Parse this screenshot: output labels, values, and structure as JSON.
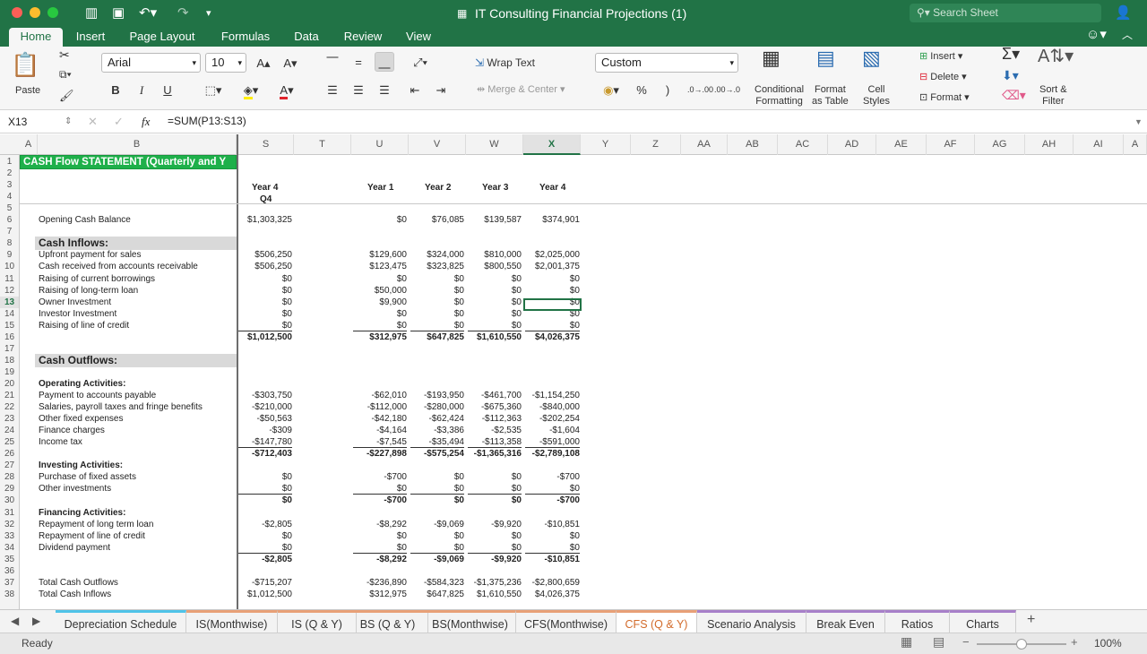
{
  "window": {
    "title": "IT Consulting  Financial Projections (1)",
    "search_placeholder": "Search Sheet"
  },
  "ribbon_tabs": [
    {
      "label": "Home",
      "active": true
    },
    {
      "label": "Insert"
    },
    {
      "label": "Page Layout"
    },
    {
      "label": "Formulas"
    },
    {
      "label": "Data"
    },
    {
      "label": "Review"
    },
    {
      "label": "View"
    }
  ],
  "ribbon": {
    "paste": "Paste",
    "font_name": "Arial",
    "font_size": "10",
    "bold": "B",
    "italic": "I",
    "underline": "U",
    "wrap_text": "Wrap Text",
    "merge_center": "Merge & Center",
    "number_format": "Custom",
    "percent": "%",
    "comma": ")",
    "cond_format": [
      "Conditional",
      "Formatting"
    ],
    "format_table": [
      "Format",
      "as Table"
    ],
    "cell_styles": [
      "Cell",
      "Styles"
    ],
    "insert": "Insert",
    "delete": "Delete",
    "format": "Format",
    "sort_filter": [
      "Sort &",
      "Filter"
    ]
  },
  "formula_bar": {
    "cell_ref": "X13",
    "fx": "fx",
    "formula": "=SUM(P13:S13)"
  },
  "columns": [
    "A",
    "B",
    "S",
    "T",
    "U",
    "V",
    "W",
    "X",
    "Y",
    "Z",
    "AA",
    "AB",
    "AC",
    "AD",
    "AE",
    "AF",
    "AG",
    "AH",
    "AI",
    "A"
  ],
  "selected_column": "X",
  "selected_row": "13",
  "sheet": {
    "title": "CASH Flow STATEMENT (Quarterly and Y",
    "headers": {
      "s": [
        "Year 4",
        "Q4"
      ],
      "u": "Year 1",
      "v": "Year 2",
      "w": "Year 3",
      "x": "Year 4"
    },
    "rows": [
      {
        "r": "1"
      },
      {
        "r": "2"
      },
      {
        "r": "3"
      },
      {
        "r": "4"
      },
      {
        "r": "5"
      },
      {
        "r": "6",
        "b": "Opening Cash Balance",
        "s": "$1,303,325",
        "u": "$0",
        "v": "$76,085",
        "w": "$139,587",
        "x": "$374,901"
      },
      {
        "r": "7"
      },
      {
        "r": "8",
        "b": "Cash Inflows:",
        "section": true
      },
      {
        "r": "9",
        "b": "Upfront payment for sales",
        "s": "$506,250",
        "u": "$129,600",
        "v": "$324,000",
        "w": "$810,000",
        "x": "$2,025,000"
      },
      {
        "r": "10",
        "b": "Cash received from accounts receivable",
        "s": "$506,250",
        "u": "$123,475",
        "v": "$323,825",
        "w": "$800,550",
        "x": "$2,001,375"
      },
      {
        "r": "11",
        "b": "Raising of current borrowings",
        "s": "$0",
        "u": "$0",
        "v": "$0",
        "w": "$0",
        "x": "$0"
      },
      {
        "r": "12",
        "b": "Raising of long-term loan",
        "s": "$0",
        "u": "$50,000",
        "v": "$0",
        "w": "$0",
        "x": "$0"
      },
      {
        "r": "13",
        "b": "Owner Investment",
        "s": "$0",
        "u": "$9,900",
        "v": "$0",
        "w": "$0",
        "x": "$0"
      },
      {
        "r": "14",
        "b": "Investor Investment",
        "s": "$0",
        "u": "$0",
        "v": "$0",
        "w": "$0",
        "x": "$0"
      },
      {
        "r": "15",
        "b": "Raising of line of credit",
        "s": "$0",
        "u": "$0",
        "v": "$0",
        "w": "$0",
        "x": "$0"
      },
      {
        "r": "16",
        "s": "$1,012,500",
        "u": "$312,975",
        "v": "$647,825",
        "w": "$1,610,550",
        "x": "$4,026,375",
        "total": true
      },
      {
        "r": "17"
      },
      {
        "r": "18",
        "b": "Cash Outflows:",
        "section": true
      },
      {
        "r": "19"
      },
      {
        "r": "20",
        "b": "Operating Activities:",
        "bold": true
      },
      {
        "r": "21",
        "b": "Payment to accounts payable",
        "s": "-$303,750",
        "u": "-$62,010",
        "v": "-$193,950",
        "w": "-$461,700",
        "x": "-$1,154,250"
      },
      {
        "r": "22",
        "b": "Salaries, payroll taxes and fringe benefits",
        "s": "-$210,000",
        "u": "-$112,000",
        "v": "-$280,000",
        "w": "-$675,360",
        "x": "-$840,000"
      },
      {
        "r": "23",
        "b": "Other fixed expenses",
        "s": "-$50,563",
        "u": "-$42,180",
        "v": "-$62,424",
        "w": "-$112,363",
        "x": "-$202,254"
      },
      {
        "r": "24",
        "b": "Finance charges",
        "s": "-$309",
        "u": "-$4,164",
        "v": "-$3,386",
        "w": "-$2,535",
        "x": "-$1,604"
      },
      {
        "r": "25",
        "b": "Income tax",
        "s": "-$147,780",
        "u": "-$7,545",
        "v": "-$35,494",
        "w": "-$113,358",
        "x": "-$591,000"
      },
      {
        "r": "26",
        "s": "-$712,403",
        "u": "-$227,898",
        "v": "-$575,254",
        "w": "-$1,365,316",
        "x": "-$2,789,108",
        "total": true
      },
      {
        "r": "27",
        "b": "Investing Activities:",
        "bold": true
      },
      {
        "r": "28",
        "b": "Purchase of fixed assets",
        "s": "$0",
        "u": "-$700",
        "v": "$0",
        "w": "$0",
        "x": "-$700"
      },
      {
        "r": "29",
        "b": "Other investments",
        "s": "$0",
        "u": "$0",
        "v": "$0",
        "w": "$0",
        "x": "$0"
      },
      {
        "r": "30",
        "s": "$0",
        "u": "-$700",
        "v": "$0",
        "w": "$0",
        "x": "-$700",
        "total": true
      },
      {
        "r": "31",
        "b": "Financing Activities:",
        "bold": true
      },
      {
        "r": "32",
        "b": "Repayment of long term loan",
        "s": "-$2,805",
        "u": "-$8,292",
        "v": "-$9,069",
        "w": "-$9,920",
        "x": "-$10,851"
      },
      {
        "r": "33",
        "b": "Repayment of line of credit",
        "s": "$0",
        "u": "$0",
        "v": "$0",
        "w": "$0",
        "x": "$0"
      },
      {
        "r": "34",
        "b": "Dividend payment",
        "s": "$0",
        "u": "$0",
        "v": "$0",
        "w": "$0",
        "x": "$0"
      },
      {
        "r": "35",
        "s": "-$2,805",
        "u": "-$8,292",
        "v": "-$9,069",
        "w": "-$9,920",
        "x": "-$10,851",
        "total": true
      },
      {
        "r": "36"
      },
      {
        "r": "37",
        "b": "Total Cash Outflows",
        "s": "-$715,207",
        "u": "-$236,890",
        "v": "-$584,323",
        "w": "-$1,375,236",
        "x": "-$2,800,659"
      },
      {
        "r": "38",
        "b": "Total Cash Inflows",
        "s": "$1,012,500",
        "u": "$312,975",
        "v": "$647,825",
        "w": "$1,610,550",
        "x": "$4,026,375"
      }
    ]
  },
  "sheet_tabs": [
    {
      "label": "Depreciation Schedule",
      "color": "#4fc3e8"
    },
    {
      "label": "IS(Monthwise)",
      "color": "#e8a077"
    },
    {
      "label": "IS (Q & Y)",
      "color": "#e8a077"
    },
    {
      "label": "BS (Q & Y)",
      "color": "#e8a077"
    },
    {
      "label": "BS(Monthwise)",
      "color": "#e8a077"
    },
    {
      "label": "CFS(Monthwise)",
      "color": "#e8a077"
    },
    {
      "label": "CFS (Q & Y)",
      "color": "#e8a077",
      "active": true
    },
    {
      "label": "Scenario Analysis",
      "color": "#a77fc9"
    },
    {
      "label": "Break Even",
      "color": "#a77fc9"
    },
    {
      "label": "Ratios",
      "color": "#a77fc9"
    },
    {
      "label": "Charts",
      "color": "#a77fc9"
    }
  ],
  "status": {
    "ready": "Ready",
    "zoom": "100%"
  },
  "colors": {
    "accent": "#217346",
    "title_fill": "#1eb04a",
    "section_fill": "#d9d9d9",
    "active_tab": "#d26b2b"
  }
}
